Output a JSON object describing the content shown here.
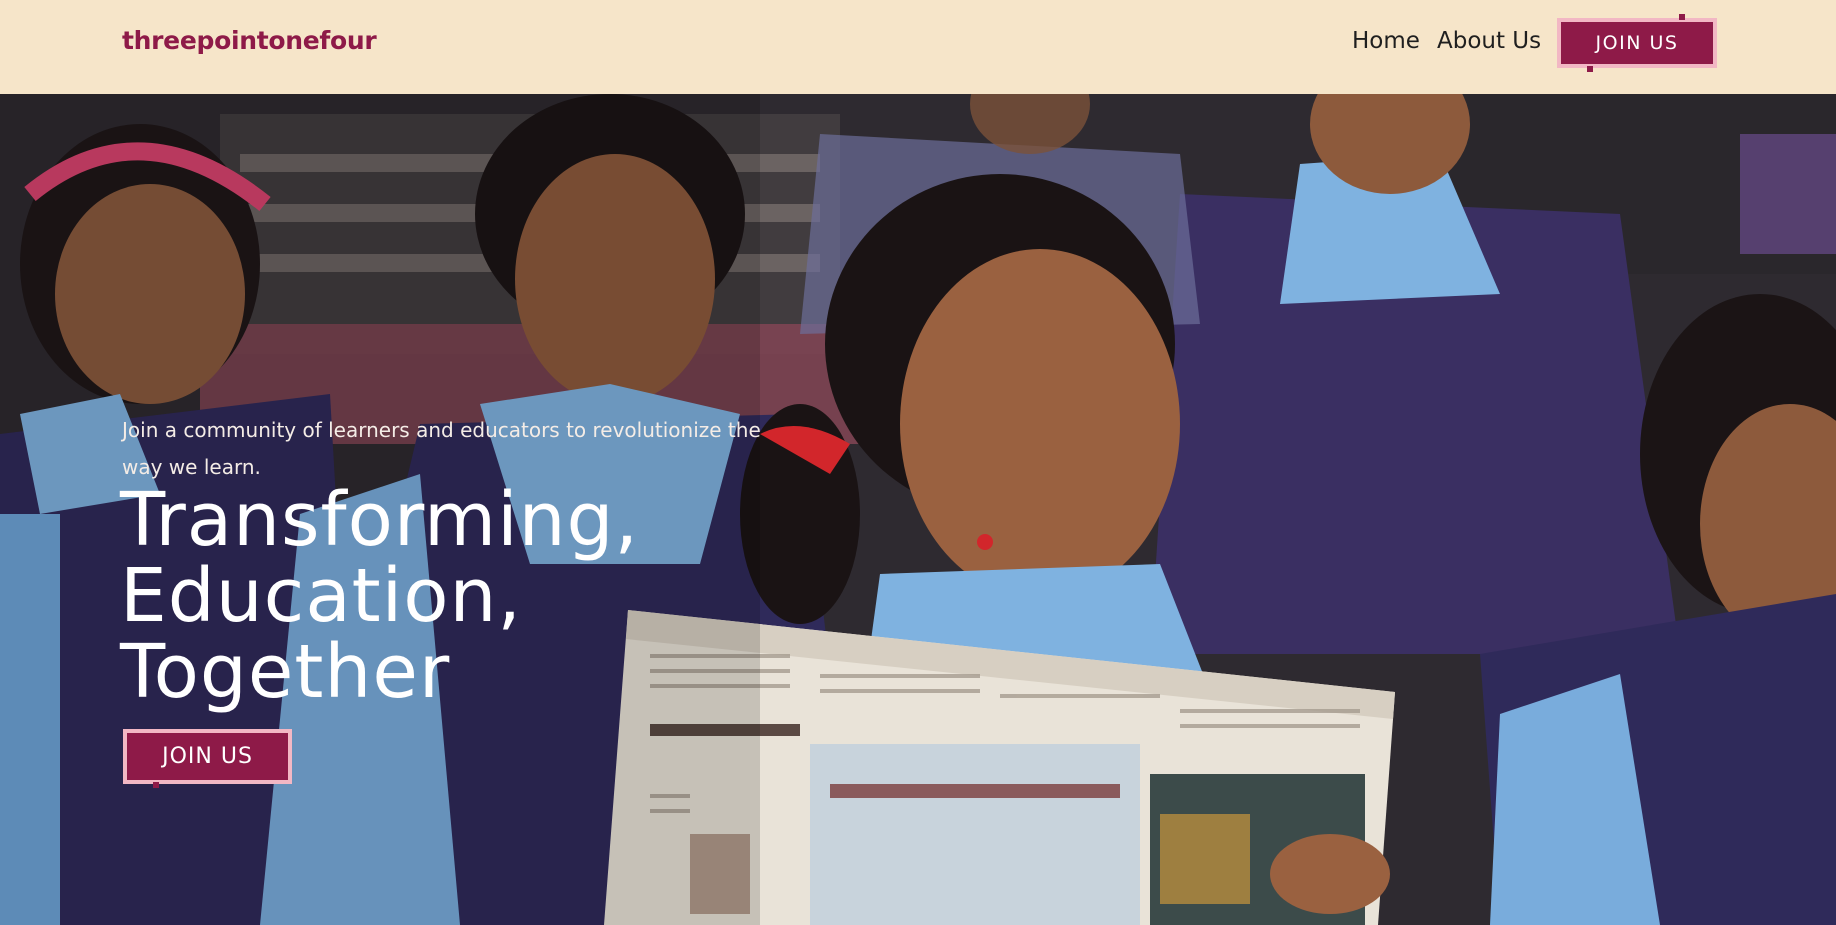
{
  "header": {
    "logo": "threepointonefour",
    "nav": [
      {
        "label": "Home"
      },
      {
        "label": "About Us"
      }
    ],
    "join_label": "JOIN US"
  },
  "hero": {
    "subtitle": "Join a community of learners and educators to revolutionize the way we learn.",
    "title_lines": [
      "Transforming,",
      "Education,",
      "Together"
    ],
    "join_label": "JOIN US",
    "image_description_icon": "classroom-photo"
  },
  "colors": {
    "header_bg": "#f6e5c9",
    "brand": "#8e1a48",
    "button_border": "#f2b7c4"
  }
}
